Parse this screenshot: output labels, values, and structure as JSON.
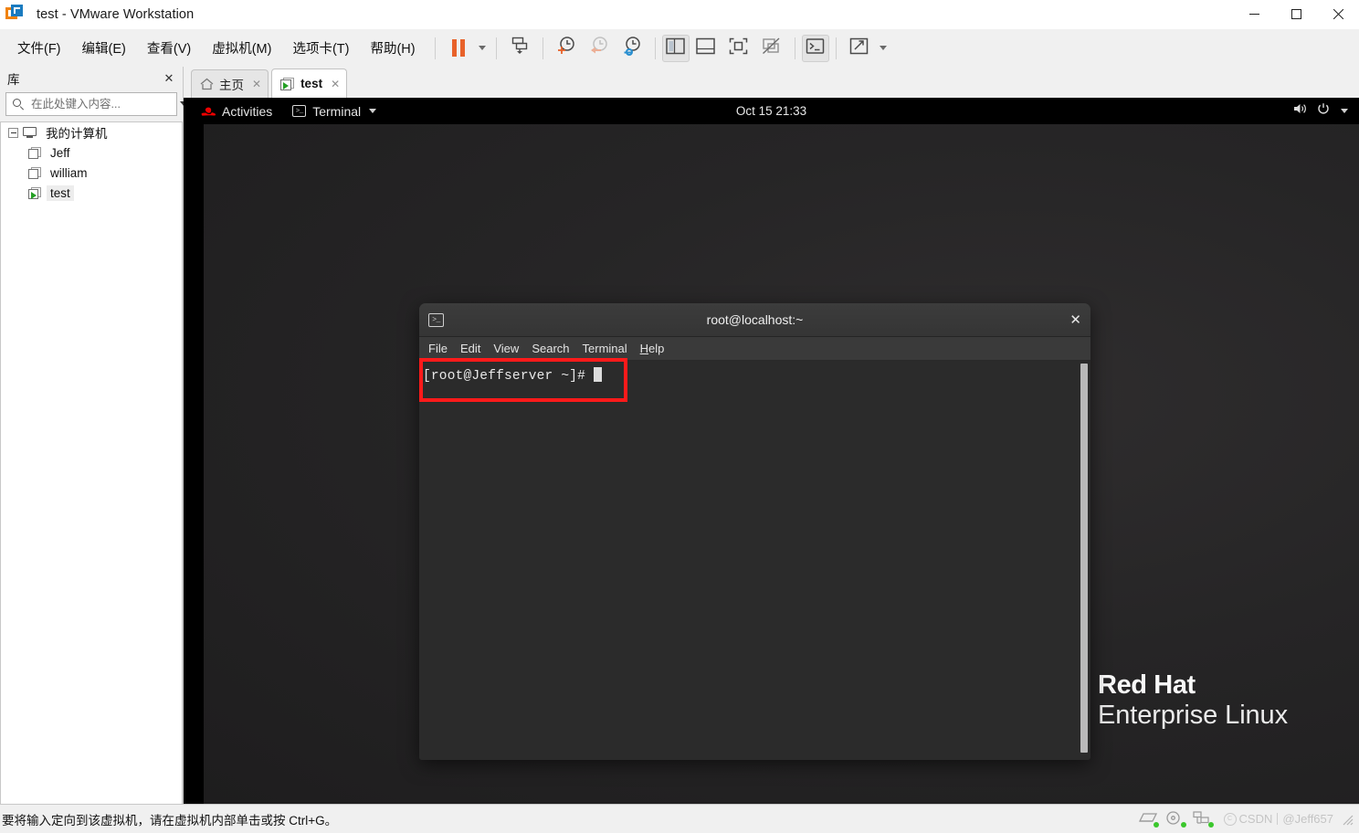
{
  "window": {
    "title": "test - VMware Workstation",
    "app_icon": "vmware-icon",
    "controls": {
      "minimize": "—",
      "maximize": "▢",
      "close": "✕"
    }
  },
  "menubar": {
    "items": [
      {
        "label": "文件(F)",
        "mnemonic": "F",
        "name": "menu-file"
      },
      {
        "label": "编辑(E)",
        "mnemonic": "E",
        "name": "menu-edit"
      },
      {
        "label": "查看(V)",
        "mnemonic": "V",
        "name": "menu-view"
      },
      {
        "label": "虚拟机(M)",
        "mnemonic": "M",
        "name": "menu-vm"
      },
      {
        "label": "选项卡(T)",
        "mnemonic": "T",
        "name": "menu-tabs"
      },
      {
        "label": "帮助(H)",
        "mnemonic": "H",
        "name": "menu-help"
      }
    ]
  },
  "toolbar": {
    "buttons": [
      {
        "name": "suspend-button",
        "icon": "pause-icon"
      },
      {
        "name": "power-dropdown",
        "icon": "chevron-down-icon"
      },
      {
        "name": "send-ctrl-alt-del-button",
        "icon": "send-key-icon"
      },
      {
        "name": "take-snapshot-button",
        "icon": "snapshot-add-icon"
      },
      {
        "name": "revert-snapshot-button",
        "icon": "snapshot-revert-icon"
      },
      {
        "name": "snapshot-manager-button",
        "icon": "snapshot-manager-icon"
      },
      {
        "name": "show-library-button",
        "icon": "library-panel-icon"
      },
      {
        "name": "show-thumbnail-bar-button",
        "icon": "thumbnail-bar-icon"
      },
      {
        "name": "enter-fullscreen-button",
        "icon": "fullscreen-icon"
      },
      {
        "name": "unity-mode-button",
        "icon": "unity-mode-icon"
      },
      {
        "name": "console-view-button",
        "icon": "console-icon"
      },
      {
        "name": "stretch-guest-button",
        "icon": "stretch-icon"
      },
      {
        "name": "stretch-dropdown",
        "icon": "chevron-down-icon"
      }
    ]
  },
  "sidebar": {
    "title": "库",
    "close_label": "✕",
    "search": {
      "placeholder": "在此处键入内容...",
      "value": ""
    },
    "tree": {
      "root": {
        "label": "我的计算机",
        "icon": "monitor-icon",
        "expanded": true
      },
      "items": [
        {
          "label": "Jeff",
          "icon": "vm-icon",
          "running": false,
          "selected": false
        },
        {
          "label": "william",
          "icon": "vm-icon",
          "running": false,
          "selected": false
        },
        {
          "label": "test",
          "icon": "vm-running-icon",
          "running": true,
          "selected": true
        }
      ]
    }
  },
  "tabs": [
    {
      "label": "主页",
      "icon": "home-icon",
      "active": false,
      "close": "✕"
    },
    {
      "label": "test",
      "icon": "vm-running-icon",
      "active": true,
      "close": "✕"
    }
  ],
  "guest": {
    "topbar": {
      "activities": "Activities",
      "app_menu": "Terminal",
      "clock": "Oct 15  21:33",
      "logo": "redhat-logo-icon",
      "volume_icon": "volume-icon",
      "power_icon": "power-icon",
      "caret_icon": "chevron-down-icon"
    },
    "terminal": {
      "title": "root@localhost:~",
      "icon": "terminal-icon",
      "close": "✕",
      "menu": [
        {
          "label": "File",
          "mnemonic": "F"
        },
        {
          "label": "Edit",
          "mnemonic": "E"
        },
        {
          "label": "View",
          "mnemonic": "V"
        },
        {
          "label": "Search",
          "mnemonic": "S"
        },
        {
          "label": "Terminal",
          "mnemonic": "T"
        },
        {
          "label": "Help",
          "mnemonic": "H"
        }
      ],
      "prompt": "[root@Jeffserver ~]# ",
      "cursor": "block"
    },
    "watermark": {
      "line1": "Red Hat",
      "line2": "Enterprise Linux",
      "logo": "redhat-hat-icon"
    },
    "highlight_color": "#ff1a1a"
  },
  "statusbar": {
    "message": "要将输入定向到该虚拟机，请在虚拟机内部单击或按 Ctrl+G。",
    "devices": [
      {
        "name": "hard-disk-icon",
        "connected": true
      },
      {
        "name": "cd-dvd-icon",
        "connected": true
      },
      {
        "name": "network-adapter-icon",
        "connected": true
      }
    ],
    "watermark": {
      "brand": "CSDN",
      "user": "@Jeff657"
    }
  },
  "colors": {
    "accent_orange": "#e8622a",
    "vm_running_green": "#24a024",
    "highlight_red": "#ff1a1a",
    "redhat_red": "#ee0000"
  }
}
